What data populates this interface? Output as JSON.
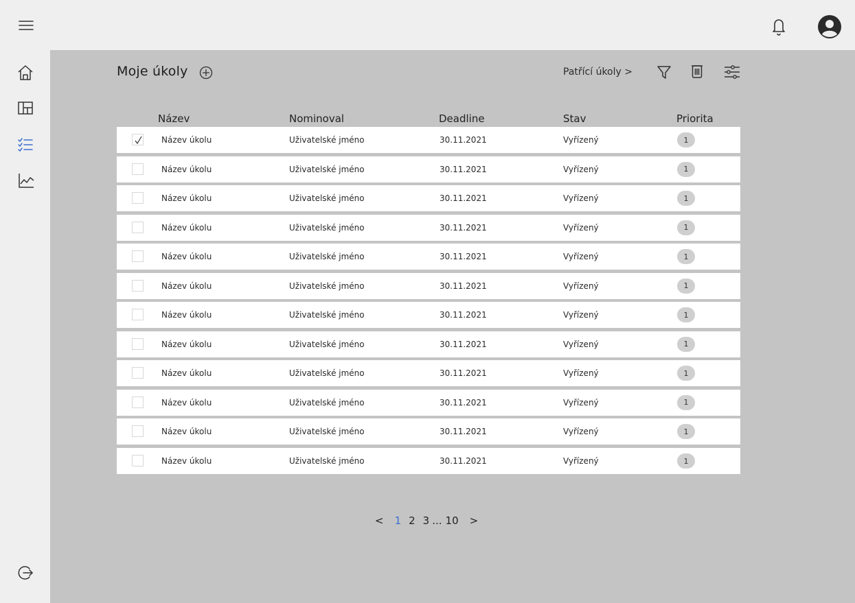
{
  "header": {
    "icons": {
      "menu": "hamburger-menu-icon",
      "notifications": "bell-icon",
      "account": "user-avatar-icon"
    }
  },
  "sidebar": {
    "items": [
      {
        "icon": "home-icon"
      },
      {
        "icon": "dashboard-icon"
      },
      {
        "icon": "tasks-icon",
        "active": true
      },
      {
        "icon": "chart-icon"
      }
    ],
    "logout_icon": "logout-icon"
  },
  "main": {
    "title": "Moje úkoly",
    "shared_link": "Patřící úkoly >",
    "columns": [
      "Název",
      "Nominoval",
      "Deadline",
      "Stav",
      "Priorita"
    ],
    "rows": [
      {
        "checked": true,
        "name": "Název úkolu",
        "nominee": "Uživatelské jméno",
        "deadline": "30.11.2021",
        "status": "Vyřízený",
        "priority": "1"
      },
      {
        "checked": false,
        "name": "Název úkolu",
        "nominee": "Uživatelské jméno",
        "deadline": "30.11.2021",
        "status": "Vyřízený",
        "priority": "1"
      },
      {
        "checked": false,
        "name": "Název úkolu",
        "nominee": "Uživatelské jméno",
        "deadline": "30.11.2021",
        "status": "Vyřízený",
        "priority": "1"
      },
      {
        "checked": false,
        "name": "Název úkolu",
        "nominee": "Uživatelské jméno",
        "deadline": "30.11.2021",
        "status": "Vyřízený",
        "priority": "1"
      },
      {
        "checked": false,
        "name": "Název úkolu",
        "nominee": "Uživatelské jméno",
        "deadline": "30.11.2021",
        "status": "Vyřízený",
        "priority": "1"
      },
      {
        "checked": false,
        "name": "Název úkolu",
        "nominee": "Uživatelské jméno",
        "deadline": "30.11.2021",
        "status": "Vyřízený",
        "priority": "1"
      },
      {
        "checked": false,
        "name": "Název úkolu",
        "nominee": "Uživatelské jméno",
        "deadline": "30.11.2021",
        "status": "Vyřízený",
        "priority": "1"
      },
      {
        "checked": false,
        "name": "Název úkolu",
        "nominee": "Uživatelské jméno",
        "deadline": "30.11.2021",
        "status": "Vyřízený",
        "priority": "1"
      },
      {
        "checked": false,
        "name": "Název úkolu",
        "nominee": "Uživatelské jméno",
        "deadline": "30.11.2021",
        "status": "Vyřízený",
        "priority": "1"
      },
      {
        "checked": false,
        "name": "Název úkolu",
        "nominee": "Uživatelské jméno",
        "deadline": "30.11.2021",
        "status": "Vyřízený",
        "priority": "1"
      },
      {
        "checked": false,
        "name": "Název úkolu",
        "nominee": "Uživatelské jméno",
        "deadline": "30.11.2021",
        "status": "Vyřízený",
        "priority": "1"
      },
      {
        "checked": false,
        "name": "Název úkolu",
        "nominee": "Uživatelské jméno",
        "deadline": "30.11.2021",
        "status": "Vyřízený",
        "priority": "1"
      }
    ],
    "pagination": {
      "prev": "<",
      "pages": [
        "1",
        "2",
        "3"
      ],
      "ellipsis": "...",
      "last": "10",
      "next": ">",
      "current": "1"
    }
  },
  "colors": {
    "accent": "#3b6ed0",
    "topbar": "#efefef",
    "canvas": "#c4c4c4",
    "row": "#ffffff",
    "badge": "#cfcfcf"
  }
}
